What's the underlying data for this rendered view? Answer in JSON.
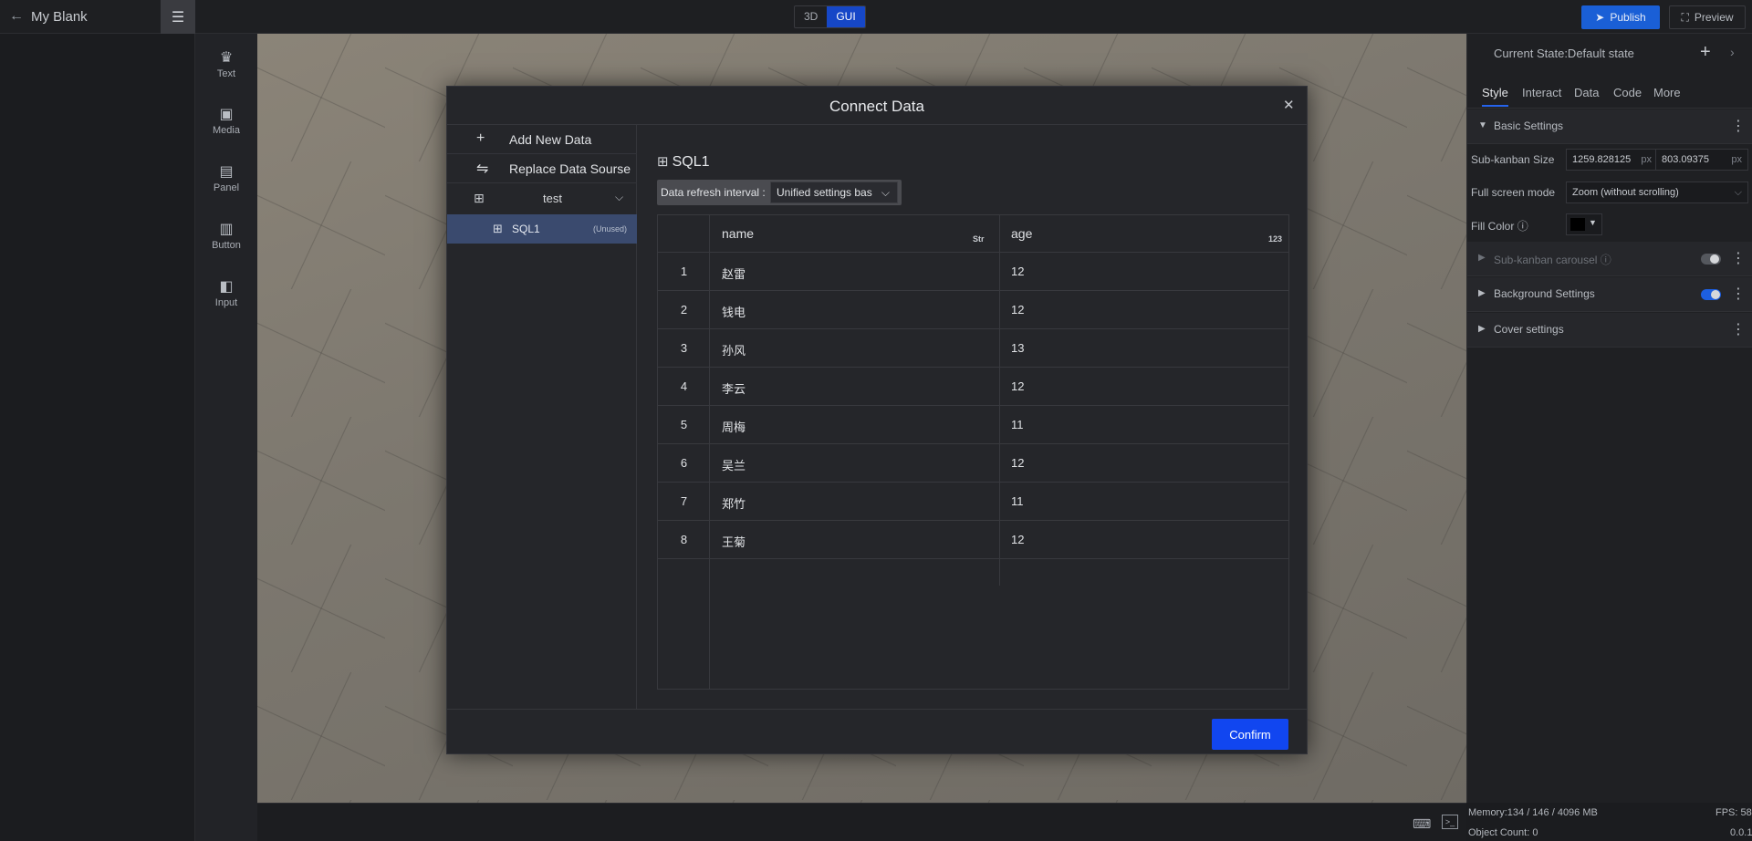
{
  "topbar": {
    "project_name": "My Blank",
    "mode_3d": "3D",
    "mode_gui": "GUI",
    "publish": "Publish",
    "preview": "Preview"
  },
  "toolbox": {
    "items": [
      {
        "label": "Text",
        "icon": "crown-icon"
      },
      {
        "label": "Media",
        "icon": "camera-icon"
      },
      {
        "label": "Panel",
        "icon": "panel-icon"
      },
      {
        "label": "Button",
        "icon": "bar-chart-icon"
      },
      {
        "label": "Input",
        "icon": "map-icon"
      }
    ]
  },
  "right_panel": {
    "state": "Current State:Default state",
    "tabs": [
      "Style",
      "Interact",
      "Data",
      "Code",
      "More"
    ],
    "basic_settings": "Basic Settings",
    "sub_kanban_size_label": "Sub-kanban Size",
    "width_value": "1259.828125",
    "height_value": "803.09375",
    "unit": "px",
    "full_screen_label": "Full screen mode",
    "full_screen_value": "Zoom (without scrolling)",
    "fill_color_label": "Fill Color",
    "fill_color": "#000000",
    "carousel": "Sub-kanban carousel",
    "background_settings": "Background Settings",
    "cover_settings": "Cover settings"
  },
  "status": {
    "memory": "Memory:134 / 146 / 4096 MB",
    "fps": "FPS: 58",
    "object_count": "Object Count: 0",
    "version": "0.0.1"
  },
  "modal": {
    "title": "Connect Data",
    "add_new": "Add New Data",
    "replace": "Replace Data Sourse",
    "group": "test",
    "source": "SQL1",
    "source_tag": "(Unused)",
    "dataset_title": "SQL1",
    "refresh_label": "Data refresh interval :",
    "refresh_value": "Unified settings bas",
    "confirm": "Confirm",
    "table": {
      "columns": [
        {
          "name": "name",
          "type": "Str"
        },
        {
          "name": "age",
          "type": "123"
        }
      ],
      "rows": [
        {
          "idx": "1",
          "name": "赵雷",
          "age": "12"
        },
        {
          "idx": "2",
          "name": "钱电",
          "age": "12"
        },
        {
          "idx": "3",
          "name": "孙风",
          "age": "13"
        },
        {
          "idx": "4",
          "name": "李云",
          "age": "12"
        },
        {
          "idx": "5",
          "name": "周梅",
          "age": "11"
        },
        {
          "idx": "6",
          "name": "吴兰",
          "age": "12"
        },
        {
          "idx": "7",
          "name": "郑竹",
          "age": "11"
        },
        {
          "idx": "8",
          "name": "王菊",
          "age": "12"
        }
      ]
    }
  },
  "colors": {
    "accent": "#1146f0",
    "selected_row": "#3a4a6e"
  }
}
